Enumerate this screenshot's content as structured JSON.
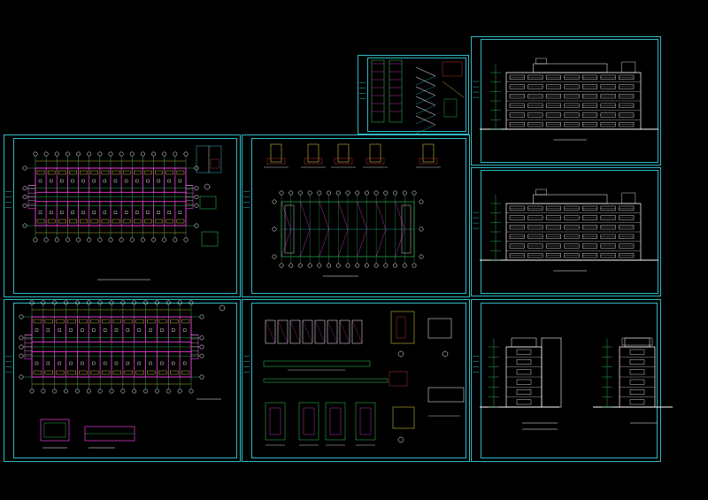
{
  "drawing_set": {
    "background": "#000000",
    "colors": {
      "frame": "#2fb9c4",
      "grid": "#32d25a",
      "wall": "#e93cd6",
      "text": "#ffffff",
      "dim": "#f0e040",
      "axis_bubble": "#ffffff",
      "hatch": "#e04040"
    },
    "sheets": [
      {
        "id": "stair-detail",
        "kind": "stair"
      },
      {
        "id": "elevation-1",
        "kind": "elevation"
      },
      {
        "id": "floor-plan-1",
        "kind": "plan"
      },
      {
        "id": "roof-plan",
        "kind": "roof"
      },
      {
        "id": "elevation-2",
        "kind": "elevation"
      },
      {
        "id": "floor-plan-2",
        "kind": "plan"
      },
      {
        "id": "details",
        "kind": "details"
      },
      {
        "id": "side-elevations",
        "kind": "side"
      }
    ]
  }
}
